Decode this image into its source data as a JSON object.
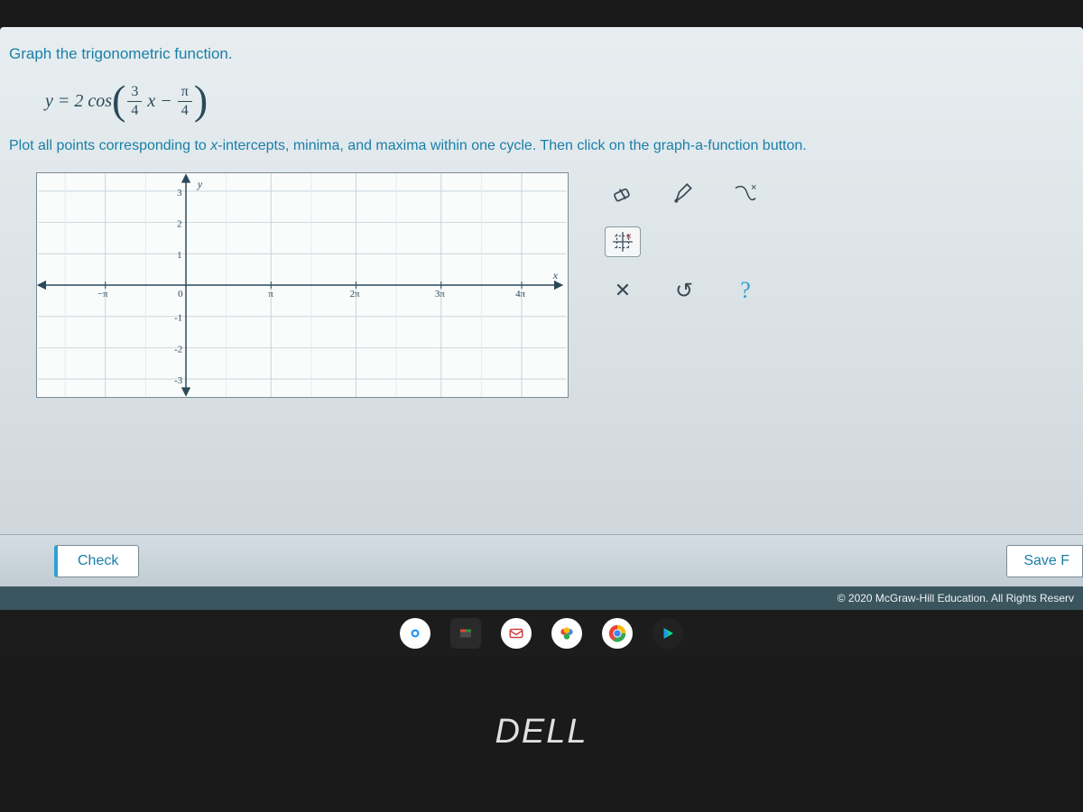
{
  "prompt": "Graph the trigonometric function.",
  "equation": {
    "lhs": "y = 2 cos",
    "frac1_num": "3",
    "frac1_den": "4",
    "mid": "x −",
    "frac2_num": "π",
    "frac2_den": "4"
  },
  "instructions_prefix": "Plot all points corresponding to ",
  "instructions_em": "x",
  "instructions_suffix": "-intercepts, minima, and maxima within one cycle. Then click on the graph-a-function button.",
  "graph": {
    "y_label": "y",
    "x_label": "x",
    "x_ticks": [
      "−π",
      "0",
      "π",
      "2π",
      "3π",
      "4π"
    ],
    "y_ticks_pos": [
      "1",
      "2",
      "3"
    ],
    "y_ticks_neg": [
      "-1",
      "-2",
      "-3"
    ]
  },
  "tools": {
    "row1": [
      "eraser",
      "pen",
      "curve"
    ],
    "row2": [
      "grid-function"
    ],
    "row3": [
      "clear",
      "undo",
      "help"
    ],
    "clear_glyph": "✕",
    "undo_glyph": "↺",
    "help_glyph": "?"
  },
  "buttons": {
    "check": "Check",
    "save": "Save F"
  },
  "copyright": "© 2020 McGraw-Hill Education. All Rights Reserv",
  "brand": "DELL"
}
